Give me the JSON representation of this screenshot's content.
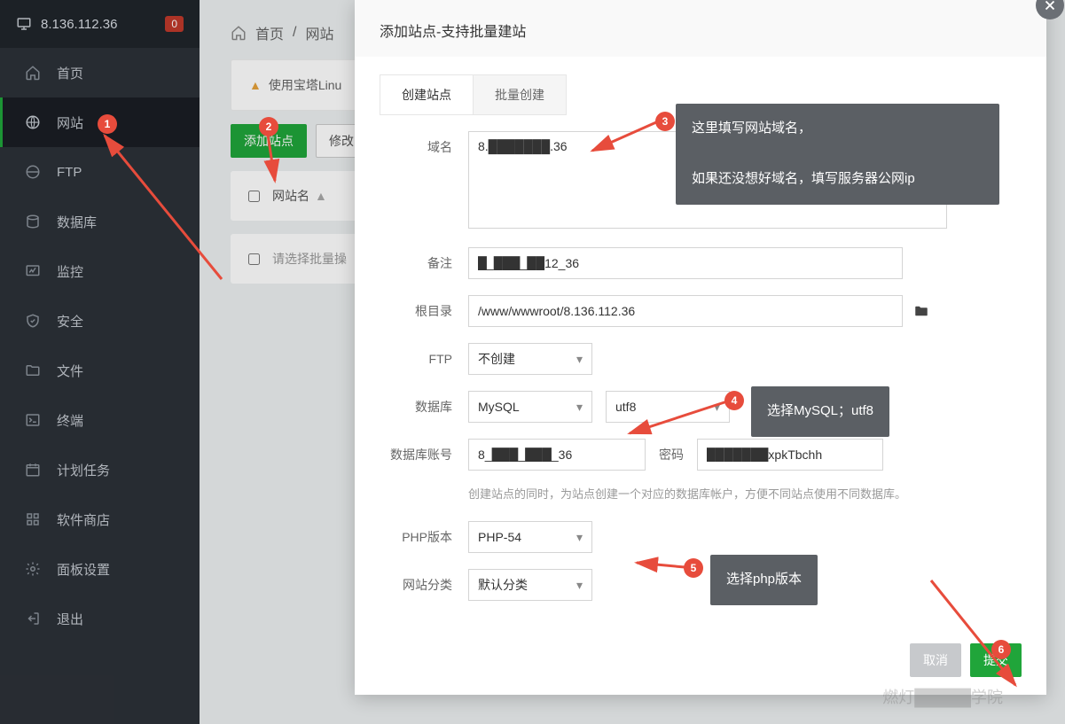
{
  "header": {
    "ip": "8.136.112.36",
    "badge": "0"
  },
  "sidebar": {
    "items": [
      {
        "label": "首页",
        "icon": "home"
      },
      {
        "label": "网站",
        "icon": "globe"
      },
      {
        "label": "FTP",
        "icon": "ftp"
      },
      {
        "label": "数据库",
        "icon": "db"
      },
      {
        "label": "监控",
        "icon": "monitor"
      },
      {
        "label": "安全",
        "icon": "shield"
      },
      {
        "label": "文件",
        "icon": "folder"
      },
      {
        "label": "终端",
        "icon": "terminal"
      },
      {
        "label": "计划任务",
        "icon": "calendar"
      },
      {
        "label": "软件商店",
        "icon": "apps"
      },
      {
        "label": "面板设置",
        "icon": "gear"
      },
      {
        "label": "退出",
        "icon": "exit"
      }
    ]
  },
  "breadcrumb": {
    "home": "首页",
    "sep": "/",
    "current": "网站"
  },
  "alert_text": "使用宝塔Linu",
  "toolbar": {
    "add_site": "添加站点",
    "modify": "修改"
  },
  "table": {
    "header_sitename": "网站名",
    "batch_placeholder": "请选择批量操"
  },
  "dialog": {
    "title": "添加站点-支持批量建站",
    "tabs": {
      "create": "创建站点",
      "batch": "批量创建"
    },
    "labels": {
      "domain": "域名",
      "remark": "备注",
      "root": "根目录",
      "ftp": "FTP",
      "database": "数据库",
      "db_account": "数据库账号",
      "password": "密码",
      "php_version": "PHP版本",
      "site_category": "网站分类"
    },
    "values": {
      "domain": "8.███████.36",
      "remark": "█_███_██12_36",
      "root": "/www/wwwroot/8.136.112.36",
      "ftp": "不创建",
      "database_type": "MySQL",
      "database_charset": "utf8",
      "db_account": "8_███_███_36",
      "password": "███████xpkTbchh",
      "php_version": "PHP-54",
      "site_category": "默认分类"
    },
    "hint": "创建站点的同时，为站点创建一个对应的数据库帐户，方便不同站点使用不同数据库。",
    "buttons": {
      "cancel": "取消",
      "submit": "提交"
    }
  },
  "annotations": {
    "n1": "1",
    "n2": "2",
    "n3": "3",
    "n4": "4",
    "n5": "5",
    "n6": "6",
    "tip3": "这里填写网站域名，\n\n如果还没想好域名，填写服务器公网ip",
    "tip4": "选择MySQL；utf8",
    "tip5": "选择php版本"
  },
  "watermark": "燃灯█████学院"
}
